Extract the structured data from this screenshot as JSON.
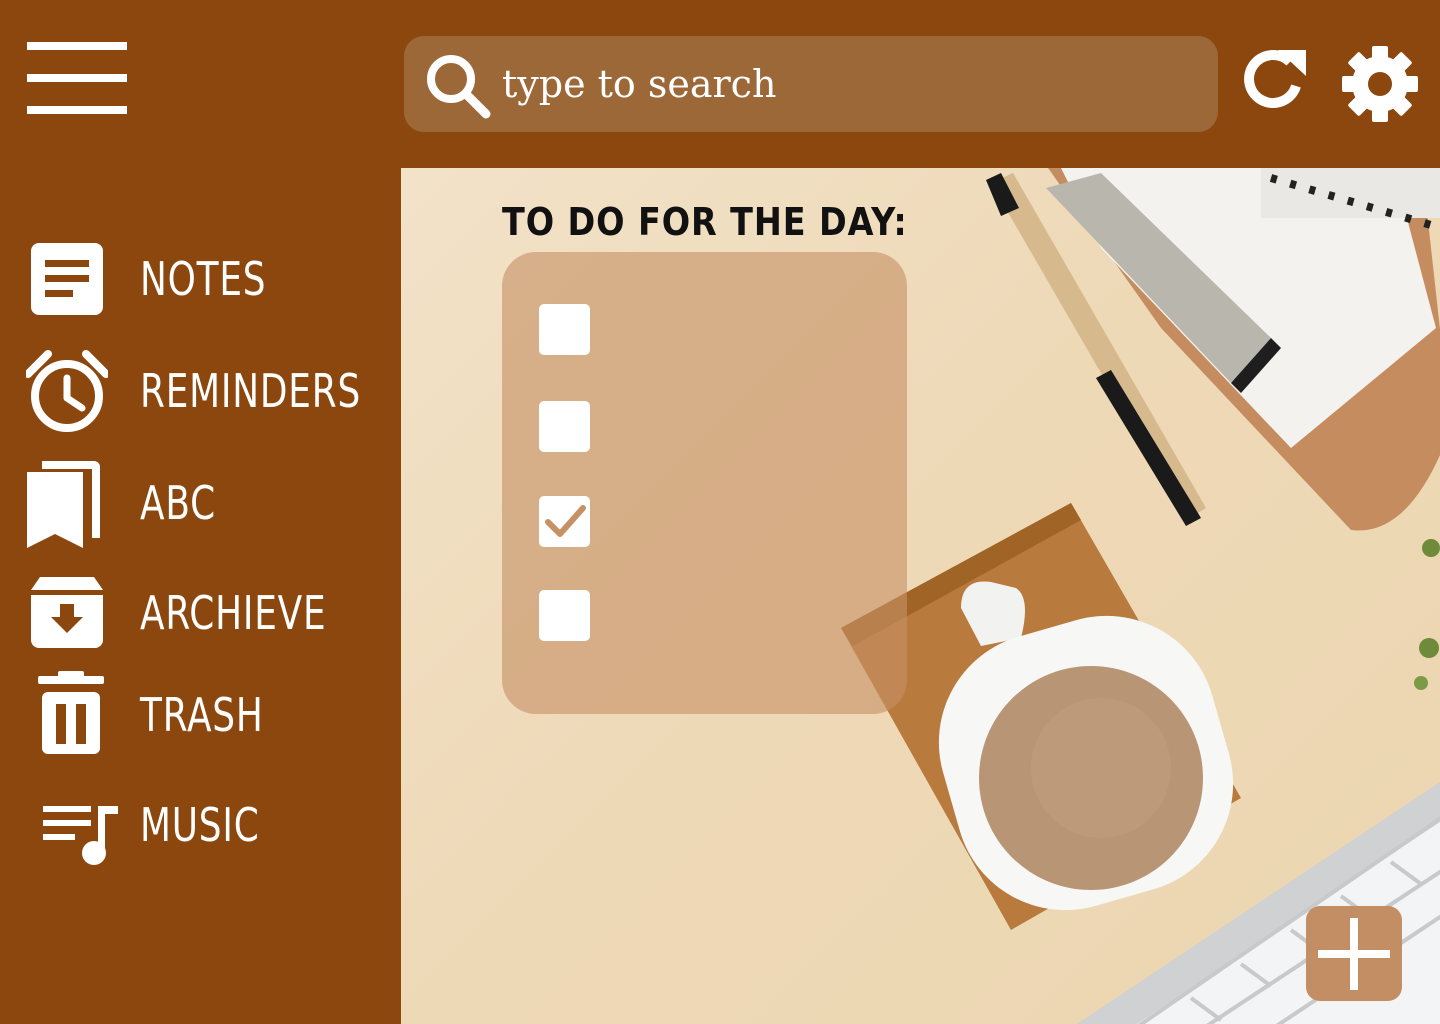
{
  "search": {
    "placeholder": "type to search"
  },
  "sidebar": {
    "items": [
      {
        "label": "NOTES",
        "icon": "notes-icon"
      },
      {
        "label": "REMINDERS",
        "icon": "alarm-clock-icon"
      },
      {
        "label": "ABC",
        "icon": "bookmark-icon"
      },
      {
        "label": "ARCHIEVE",
        "icon": "archive-icon"
      },
      {
        "label": "TRASH",
        "icon": "trash-icon"
      },
      {
        "label": "MUSIC",
        "icon": "music-list-icon"
      }
    ]
  },
  "todo": {
    "title": "TO DO FOR THE DAY:",
    "items": [
      {
        "checked": false
      },
      {
        "checked": false
      },
      {
        "checked": true
      },
      {
        "checked": false
      }
    ]
  },
  "colors": {
    "sidebar": "#8b470d",
    "search_field": "#9d6838",
    "todo_card": "#c69265",
    "add_button": "#c38e64",
    "background": "#f2e2c8"
  },
  "icons": {
    "menu": "hamburger-menu-icon",
    "search": "search-icon",
    "refresh": "refresh-icon",
    "settings": "gear-icon",
    "add": "plus-icon",
    "checkmark": "checkmark-icon"
  }
}
